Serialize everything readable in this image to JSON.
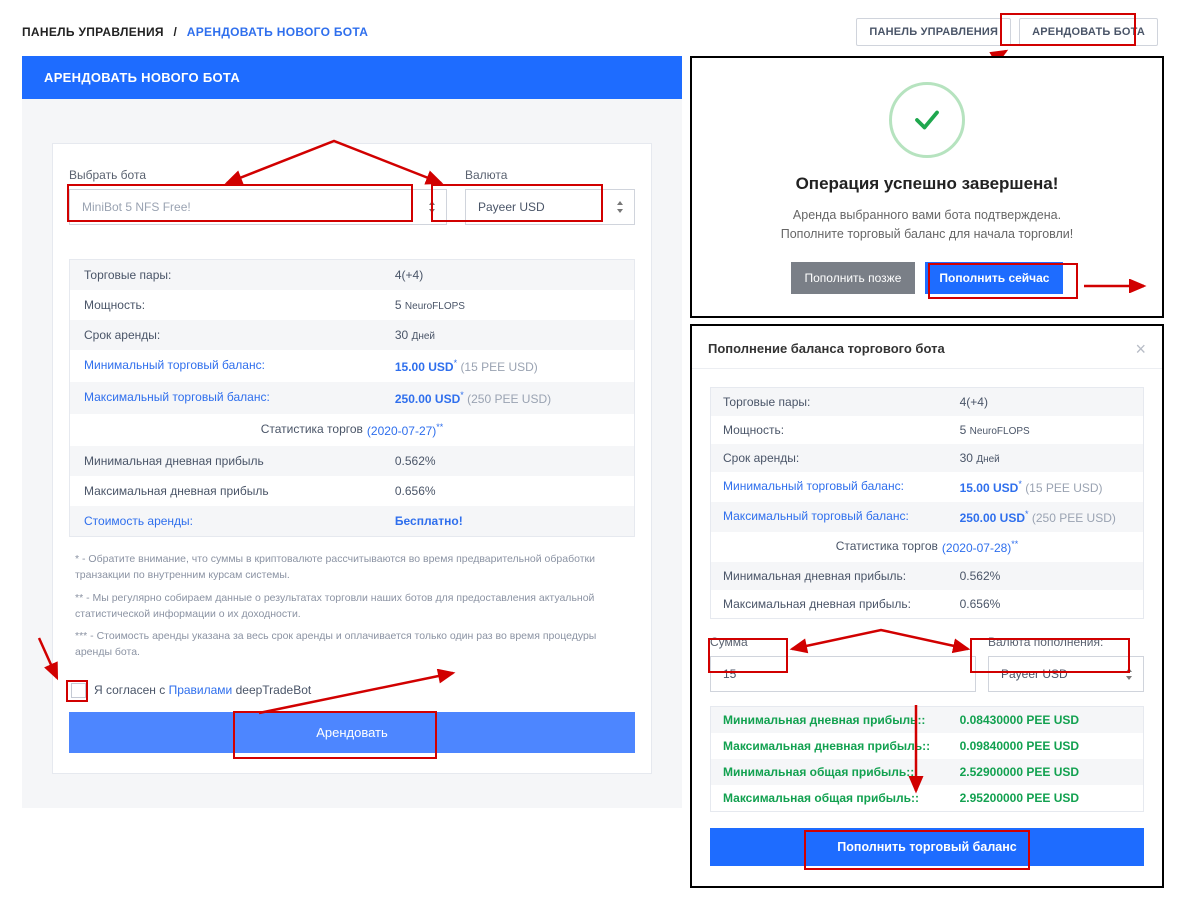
{
  "breadcrumb": {
    "l1": "ПАНЕЛЬ УПРАВЛЕНИЯ",
    "sep": "/",
    "l2": "АРЕНДОВАТЬ НОВОГО БОТА"
  },
  "topbuttons": {
    "dashboard": "ПАНЕЛЬ УПРАВЛЕНИЯ",
    "rent": "АРЕНДОВАТЬ БОТА"
  },
  "left": {
    "header": "АРЕНДОВАТЬ НОВОГО БОТА",
    "select_bot_label": "Выбрать бота",
    "select_bot_value": "MiniBot 5 NFS Free!",
    "currency_label": "Валюта",
    "currency_value": "Payeer USD",
    "rows": {
      "pairs_k": "Торговые пары:",
      "pairs_v": "4(+4)",
      "power_k": "Мощность:",
      "power_v_num": "5",
      "power_v_unit": "NeuroFLOPS",
      "term_k": "Срок аренды:",
      "term_v_num": "30",
      "term_v_unit": "Дней",
      "minbal_k": "Минимальный торговый баланс:",
      "minbal_v": "15.00 USD",
      "minbal_note": "(15 PEE USD)",
      "maxbal_k": "Максимальный торговый баланс:",
      "maxbal_v": "250.00 USD",
      "maxbal_note": "(250 PEE USD)",
      "stats_t": "Статистика торгов",
      "stats_date": "(2020-07-27)",
      "mindaily_k": "Минимальная дневная прибыль",
      "mindaily_v": "0.562%",
      "maxdaily_k": "Максимальная дневная прибыль",
      "maxdaily_v": "0.656%",
      "cost_k": "Стоимость аренды:",
      "cost_v": "Бесплатно!"
    },
    "notes": {
      "n1": "* - Обратите внимание, что суммы в криптовалюте рассчитываются во время предварительной обработки транзакции по внутренним курсам системы.",
      "n2": "** - Мы регулярно собираем данные о результатах торговли наших ботов для предоставления актуальной статистической информации о их доходности.",
      "n3": "*** - Стоимость аренды указана за весь срок аренды и оплачивается только один раз во время процедуры аренды бота."
    },
    "agree_pre": "Я согласен с ",
    "agree_link": "Правилами",
    "agree_post": " deepTradeBot",
    "rent_button": "Арендовать"
  },
  "modal1": {
    "title": "Операция успешно завершена!",
    "text_l1": "Аренда выбранного вами бота подтверждена.",
    "text_l2": "Пополните торговый баланс для начала торговли!",
    "later": "Пополнить позже",
    "now": "Пополнить сейчас"
  },
  "modal2": {
    "title": "Пополнение баланса торгового бота",
    "rows": {
      "pairs_k": "Торговые пары:",
      "pairs_v": "4(+4)",
      "power_k": "Мощность:",
      "power_v_num": "5",
      "power_v_unit": "NeuroFLOPS",
      "term_k": "Срок аренды:",
      "term_v_num": "30",
      "term_v_unit": "Дней",
      "minbal_k": "Минимальный торговый баланс:",
      "minbal_v": "15.00 USD",
      "minbal_note": "(15 PEE USD)",
      "maxbal_k": "Максимальный торговый баланс:",
      "maxbal_v": "250.00 USD",
      "maxbal_note": "(250 PEE USD)",
      "stats_t": "Статистика торгов",
      "stats_date": "(2020-07-28)",
      "mindaily_k": "Минимальная дневная прибыль:",
      "mindaily_v": "0.562%",
      "maxdaily_k": "Максимальная дневная прибыль:",
      "maxdaily_v": "0.656%"
    },
    "amount_label": "Сумма",
    "amount_value": "15",
    "curr_label": "Валюта пополнения:",
    "curr_value": "Payeer USD",
    "profits": {
      "p1k": "Минимальная дневная прибыль::",
      "p1v": "0.08430000 PEE USD",
      "p2k": "Максимальная дневная прибыль::",
      "p2v": "0.09840000 PEE USD",
      "p3k": "Минимальная общая прибыль::",
      "p3v": "2.52900000 PEE USD",
      "p4k": "Максимальная общая прибыль::",
      "p4v": "2.95200000 PEE USD"
    },
    "submit": "Пополнить торговый баланс"
  },
  "colors": {
    "red": "#d10000"
  }
}
